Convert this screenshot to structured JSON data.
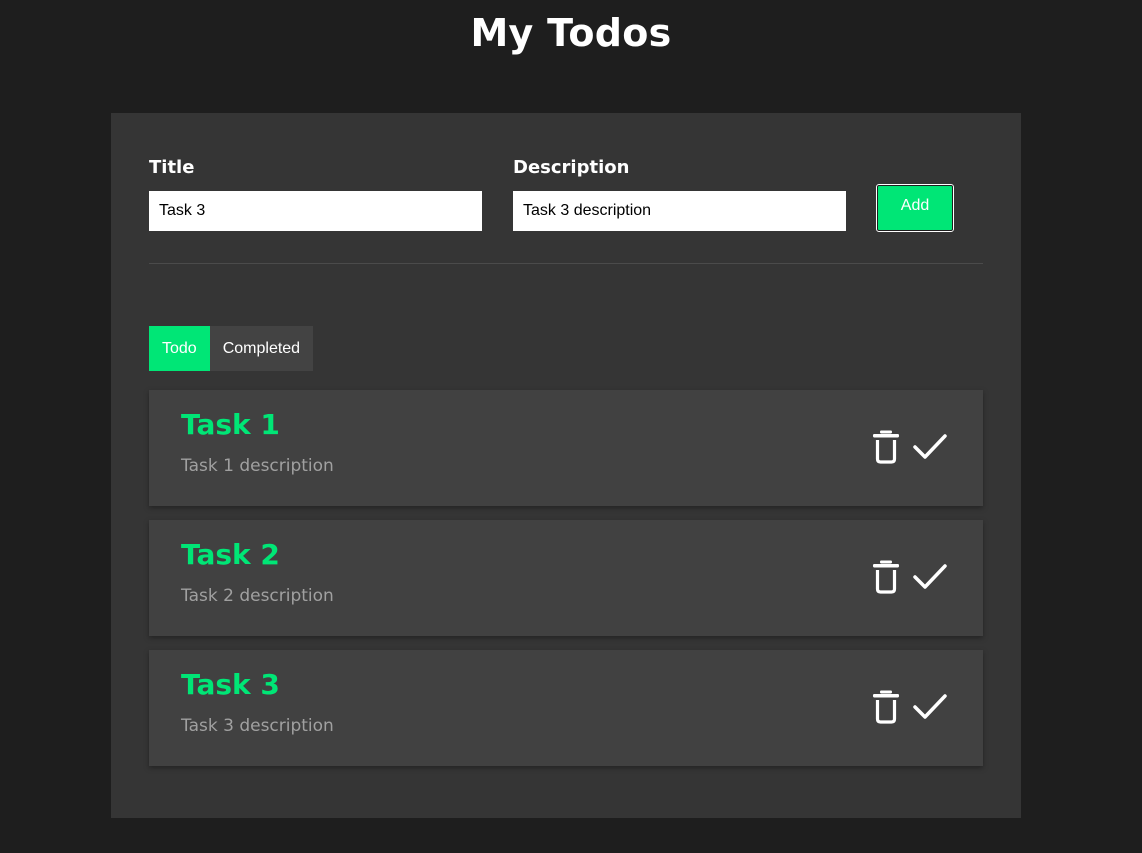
{
  "header": {
    "title": "My Todos"
  },
  "form": {
    "title_label": "Title",
    "title_value": "Task 3",
    "description_label": "Description",
    "description_value": "Task 3 description",
    "add_label": "Add"
  },
  "tabs": [
    {
      "label": "Todo",
      "active": true
    },
    {
      "label": "Completed",
      "active": false
    }
  ],
  "todos": [
    {
      "title": "Task 1",
      "description": "Task 1 description"
    },
    {
      "title": "Task 2",
      "description": "Task 2 description"
    },
    {
      "title": "Task 3",
      "description": "Task 3 description"
    }
  ],
  "icons": {
    "delete": "trash-icon",
    "complete": "check-icon"
  },
  "colors": {
    "background": "#1e1e1e",
    "panel": "#353535",
    "card": "#414141",
    "accent": "#00e676",
    "muted_text": "#a0a0a0"
  }
}
